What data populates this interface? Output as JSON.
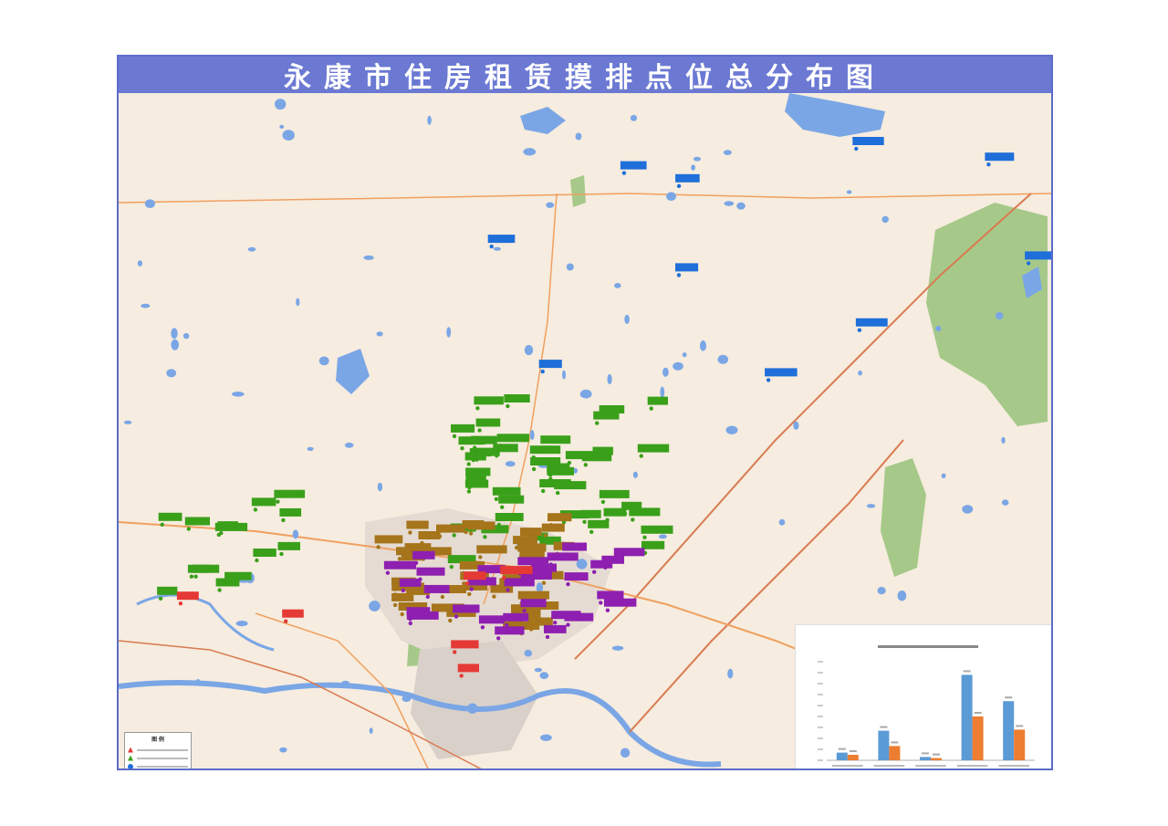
{
  "title": "永康市住房租赁摸排点位总分布图",
  "legend": {
    "title": "图 例",
    "items": [
      {
        "symbol": "triangle",
        "color": "#e53935"
      },
      {
        "symbol": "triangle",
        "color": "#3aa01a"
      },
      {
        "symbol": "circle",
        "color": "#1e6fd9"
      },
      {
        "symbol": "square",
        "color": "#a5741b"
      },
      {
        "symbol": "circle",
        "color": "#8e1fb0"
      }
    ]
  },
  "colors": {
    "land": "#f6ecdf",
    "water": "#7aa6e6",
    "forest": "#a6c98a",
    "road_main": "#f0a060",
    "road_rail": "#d97a50",
    "urban": "#d9d0c9",
    "label_green": "#3aa01a",
    "label_blue": "#1e6fd9",
    "label_red": "#e53935",
    "label_brown": "#a5741b",
    "label_purple": "#8e1fb0",
    "bar_blue": "#5b9bd5",
    "bar_orange": "#ed7d31",
    "title_bar": "#6b79d3"
  },
  "chart_data": {
    "type": "bar",
    "title": "",
    "categories": [
      "",
      "",
      "",
      "",
      ""
    ],
    "series": [
      {
        "name": "",
        "values": [
          7,
          27,
          3,
          78,
          54
        ]
      },
      {
        "name": "",
        "values": [
          5,
          13,
          2,
          40,
          28
        ]
      }
    ],
    "ylim": [
      0,
      90
    ],
    "legend_position": "bottom",
    "grid": false
  }
}
